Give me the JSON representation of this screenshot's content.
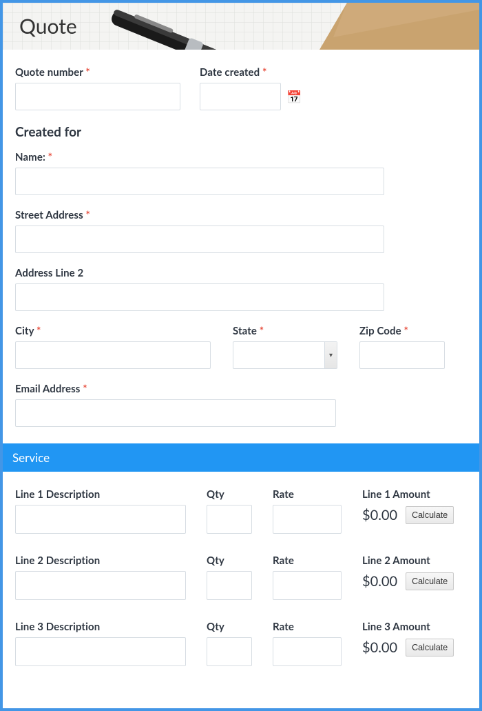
{
  "title": "Quote",
  "fields": {
    "quote_number": {
      "label": "Quote number",
      "required": true,
      "value": ""
    },
    "date_created": {
      "label": "Date created",
      "required": true,
      "value": ""
    }
  },
  "created_for": {
    "heading": "Created for",
    "name": {
      "label": "Name:",
      "required": true,
      "value": ""
    },
    "street": {
      "label": "Street Address",
      "required": true,
      "value": ""
    },
    "addr2": {
      "label": "Address Line 2",
      "required": false,
      "value": ""
    },
    "city": {
      "label": "City",
      "required": true,
      "value": ""
    },
    "state": {
      "label": "State",
      "required": true,
      "value": ""
    },
    "zip": {
      "label": "Zip Code",
      "required": true,
      "value": ""
    },
    "email": {
      "label": "Email Address",
      "required": true,
      "value": ""
    }
  },
  "service": {
    "heading": "Service",
    "common": {
      "qty_label": "Qty",
      "rate_label": "Rate",
      "calc_label": "Calculate"
    },
    "lines": [
      {
        "desc_label": "Line 1 Description",
        "amount_label": "Line 1 Amount",
        "amount": "$0.00",
        "desc": "",
        "qty": "",
        "rate": ""
      },
      {
        "desc_label": "Line 2 Description",
        "amount_label": "Line 2 Amount",
        "amount": "$0.00",
        "desc": "",
        "qty": "",
        "rate": ""
      },
      {
        "desc_label": "Line 3 Description",
        "amount_label": "Line 3 Amount",
        "amount": "$0.00",
        "desc": "",
        "qty": "",
        "rate": ""
      }
    ]
  }
}
